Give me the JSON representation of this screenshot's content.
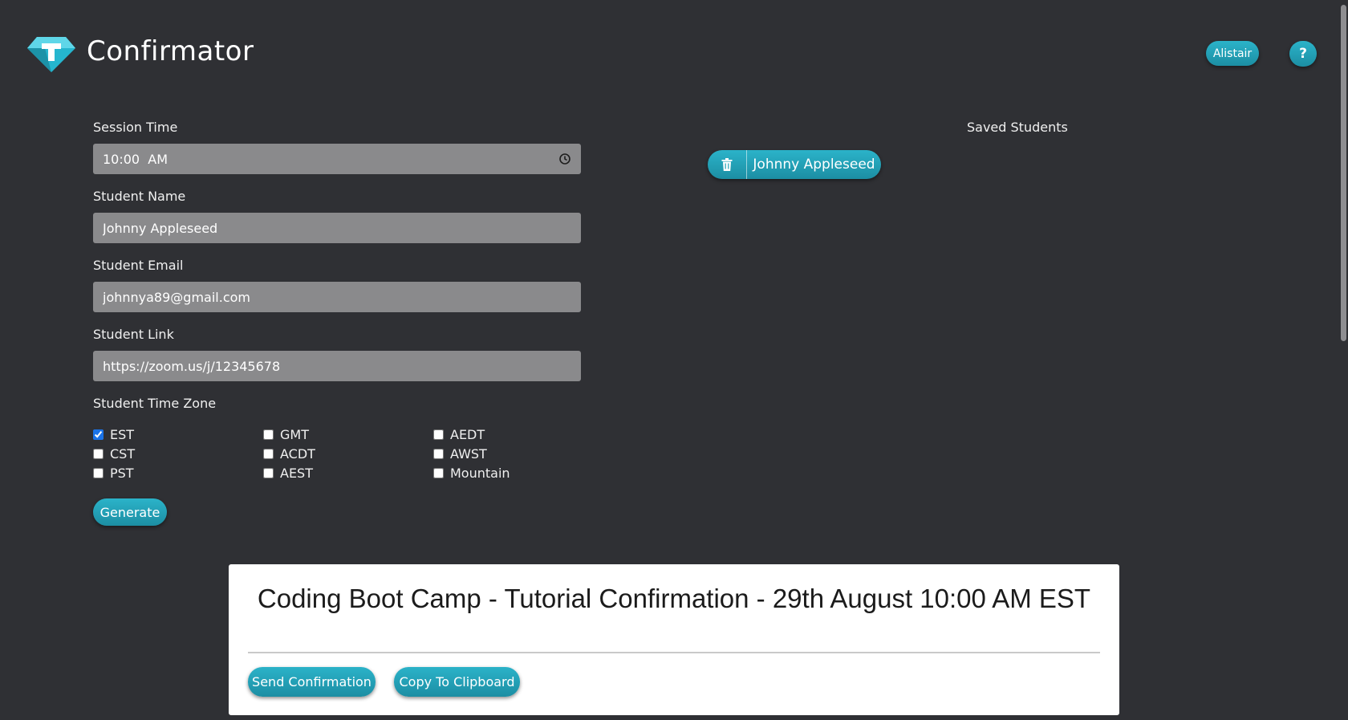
{
  "header": {
    "app_title": "Confirmator",
    "user_button": "Alistair",
    "help_button": "?"
  },
  "form": {
    "session_time": {
      "label": "Session Time",
      "value": "10:00  AM"
    },
    "student_name": {
      "label": "Student Name",
      "value": "Johnny Appleseed"
    },
    "student_email": {
      "label": "Student Email",
      "value": "johnnya89@gmail.com"
    },
    "student_link": {
      "label": "Student Link",
      "value": "https://zoom.us/j/12345678"
    },
    "timezone": {
      "label": "Student Time Zone",
      "options": [
        {
          "label": "EST",
          "checked": true
        },
        {
          "label": "GMT",
          "checked": false
        },
        {
          "label": "AEDT",
          "checked": false
        },
        {
          "label": "CST",
          "checked": false
        },
        {
          "label": "ACDT",
          "checked": false
        },
        {
          "label": "AWST",
          "checked": false
        },
        {
          "label": "PST",
          "checked": false
        },
        {
          "label": "AEST",
          "checked": false
        },
        {
          "label": "Mountain",
          "checked": false
        }
      ]
    },
    "generate_button": "Generate"
  },
  "saved_students": {
    "title": "Saved Students",
    "items": [
      {
        "name": "Johnny Appleseed"
      }
    ]
  },
  "confirmation": {
    "title": "Coding Boot Camp - Tutorial Confirmation - 29th August 10:00 AM EST",
    "send_button": "Send Confirmation",
    "copy_button": "Copy To Clipboard"
  },
  "colors": {
    "background": "#2f3034",
    "accent": "#2bb3c9",
    "field": "#8a8a8c",
    "panel": "#ffffff"
  }
}
